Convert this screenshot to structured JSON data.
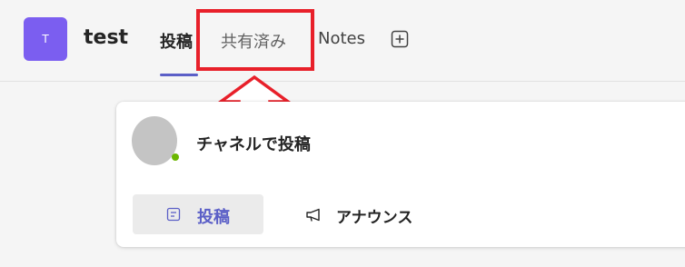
{
  "header": {
    "team_avatar_initial": "T",
    "team_name": "test",
    "tabs": [
      {
        "label": "投稿",
        "selected": true
      },
      {
        "label": "共有済み",
        "selected": false
      },
      {
        "label": "Notes",
        "selected": false
      }
    ],
    "add_tab_icon": "plus-square-icon"
  },
  "annotation": {
    "highlight_color": "#e8202a",
    "arrow_icon": "up-arrow-outline-icon"
  },
  "compose": {
    "channel_post_label": "チャネルで投稿",
    "post_button": {
      "label": "投稿",
      "icon": "post-icon"
    },
    "announce_button": {
      "label": "アナウンス",
      "icon": "megaphone-icon"
    }
  },
  "colors": {
    "accent": "#5b5fc7",
    "team_avatar_bg": "#7b5ef0",
    "presence": "#6bb700"
  }
}
